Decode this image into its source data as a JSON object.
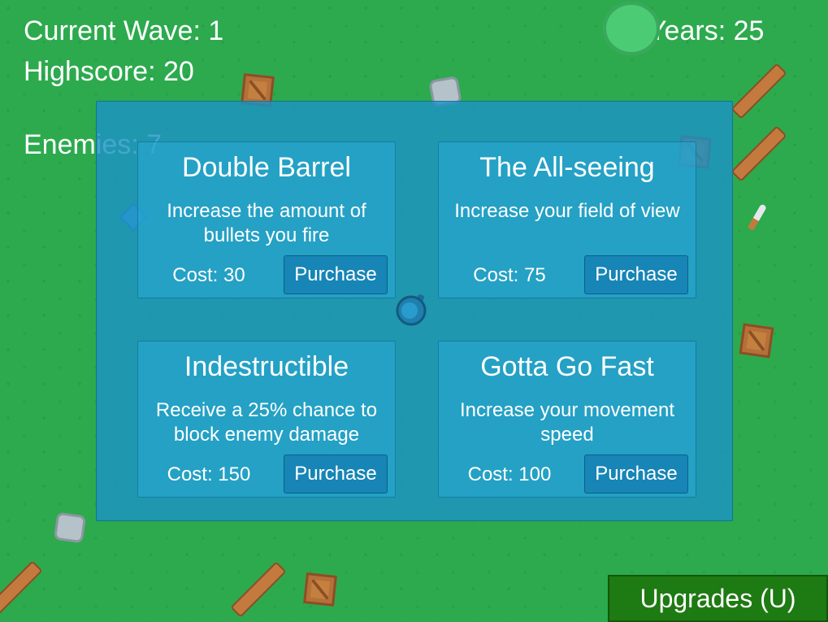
{
  "hud": {
    "current_wave": "Current Wave: 1",
    "highscore": "Highscore: 20",
    "enemies": "Enemies: 7",
    "years": "Years: 25"
  },
  "upgrades": [
    {
      "title": "Double Barrel",
      "description": "Increase the amount of bullets you fire",
      "cost": "Cost: 30",
      "button": "Purchase"
    },
    {
      "title": "The All-seeing",
      "description": "Increase your field of view",
      "cost": "Cost: 75",
      "button": "Purchase"
    },
    {
      "title": "Indestructible",
      "description": "Receive a 25% chance to block enemy damage",
      "cost": "Cost: 150",
      "button": "Purchase"
    },
    {
      "title": "Gotta Go Fast",
      "description": "Increase your movement speed",
      "cost": "Cost: 100",
      "button": "Purchase"
    }
  ],
  "upgrades_button": "Upgrades (U)",
  "colors": {
    "grass": "#2daa4e",
    "panel": "#1c92c4",
    "upgrades_button": "#1e7a12"
  }
}
